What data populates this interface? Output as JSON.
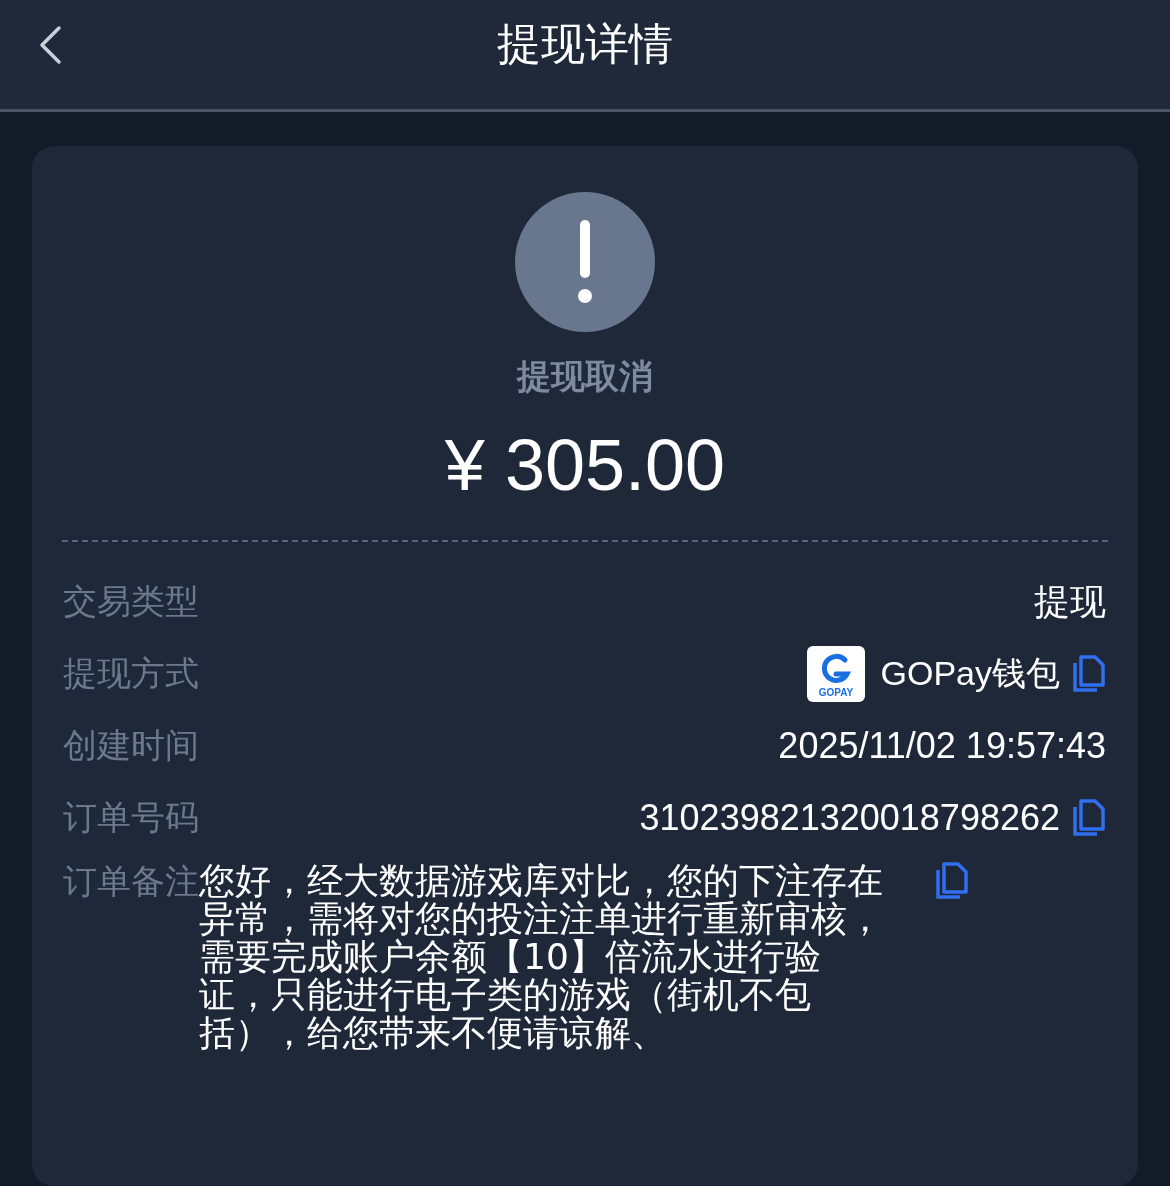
{
  "header": {
    "title": "提现详情"
  },
  "status": {
    "kind": "cancelled",
    "label": "提现取消"
  },
  "amount": "¥ 305.00",
  "rows": [
    {
      "kind": "text",
      "label": "交易类型",
      "value": "提现",
      "copyable": false
    },
    {
      "kind": "method",
      "label": "提现方式",
      "logo_text": "GOPAY",
      "value": "GOPay钱包",
      "copyable": true
    },
    {
      "kind": "text",
      "label": "创建时间",
      "value": "2025/11/02 19:57:43",
      "copyable": false
    },
    {
      "kind": "text",
      "label": "订单号码",
      "value": "310239821320018798262",
      "copyable": true
    },
    {
      "kind": "note",
      "label": "订单备注",
      "value": "您好，经大数据游戏库对比，您的下注存在异常，需将对您的投注注单进行重新审核，需要完成账户余额【10】倍流水进行验证，只能进行电子类的游戏（街机不包括），给您带来不便请谅解、",
      "copyable": true
    }
  ]
}
